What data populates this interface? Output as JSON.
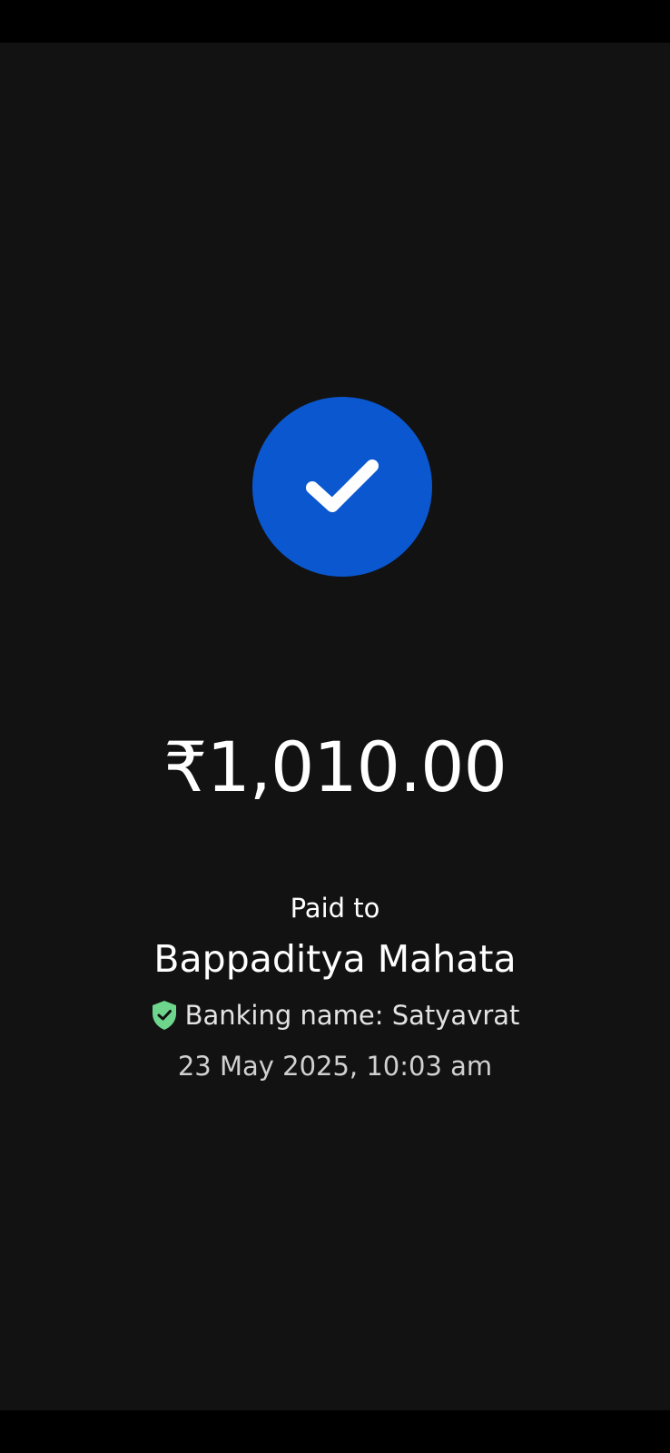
{
  "payment": {
    "status_icon": "check-icon",
    "amount": "₹1,010.00",
    "paid_to_label": "Paid to",
    "payee_name": "Bappaditya Mahata",
    "banking_name": "Banking name: Satyavrat",
    "verified_icon": "shield-check-icon",
    "timestamp": "23 May 2025, 10:03 am"
  },
  "colors": {
    "background": "#121212",
    "accent": "#0b57d0",
    "verified": "#6dd58c",
    "text": "#ffffff"
  }
}
